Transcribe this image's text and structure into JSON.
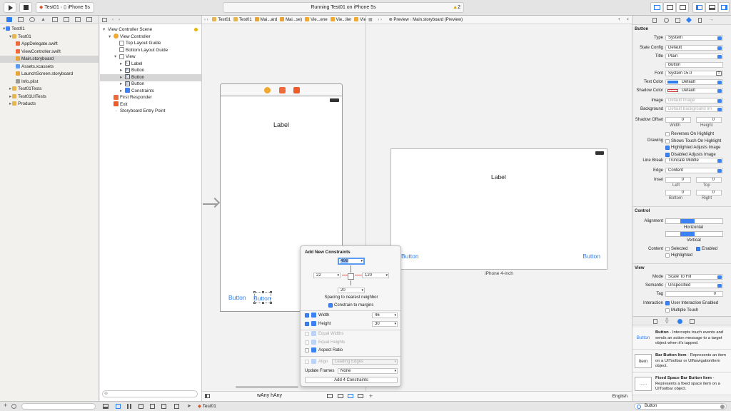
{
  "toolbar": {
    "scheme_project": "Test01",
    "scheme_device": "iPhone 5s",
    "status": "Running Test01 on iPhone 5s",
    "warnings": "2"
  },
  "navigator": {
    "items": [
      {
        "label": "Test01",
        "level": 0,
        "kind": "project"
      },
      {
        "label": "Test01",
        "level": 1,
        "kind": "folder"
      },
      {
        "label": "AppDelegate.swift",
        "level": 2,
        "kind": "swift"
      },
      {
        "label": "ViewController.swift",
        "level": 2,
        "kind": "swift"
      },
      {
        "label": "Main.storyboard",
        "level": 2,
        "kind": "storyboard"
      },
      {
        "label": "Assets.xcassets",
        "level": 2,
        "kind": "assets"
      },
      {
        "label": "LaunchScreen.storyboard",
        "level": 2,
        "kind": "storyboard"
      },
      {
        "label": "Info.plist",
        "level": 2,
        "kind": "plist"
      },
      {
        "label": "Test01Tests",
        "level": 1,
        "kind": "folder"
      },
      {
        "label": "Test01UITests",
        "level": 1,
        "kind": "folder"
      },
      {
        "label": "Products",
        "level": 1,
        "kind": "folder"
      }
    ]
  },
  "jumpbar": {
    "crumbs": [
      "Test01",
      "Test01",
      "Mai...ard",
      "Mai...se)",
      "Vie...ene",
      "Vie...ller",
      "View",
      "Button"
    ],
    "preview": "Preview",
    "preview_file": "Main.storyboard (Preview)"
  },
  "outline": {
    "items": [
      {
        "label": "View Controller Scene",
        "level": 0
      },
      {
        "label": "View Controller",
        "level": 1
      },
      {
        "label": "Top Layout Guide",
        "level": 2
      },
      {
        "label": "Bottom Layout Guide",
        "level": 2
      },
      {
        "label": "View",
        "level": 2
      },
      {
        "label": "Label",
        "level": 3,
        "badge": "L"
      },
      {
        "label": "Button",
        "level": 3,
        "badge": "B"
      },
      {
        "label": "Button",
        "level": 3,
        "badge": "B"
      },
      {
        "label": "Button",
        "level": 3,
        "badge": "B"
      },
      {
        "label": "Constraints",
        "level": 3,
        "badge": ""
      },
      {
        "label": "First Responder",
        "level": 1
      },
      {
        "label": "Exit",
        "level": 1
      },
      {
        "label": "Storyboard Entry Point",
        "level": 1
      }
    ]
  },
  "canvas": {
    "label": "Label",
    "button_left": "Button",
    "button_sel": "Button",
    "size_w": "wAny",
    "size_h": "hAny"
  },
  "preview": {
    "label": "Label",
    "button_left": "Button",
    "button_right": "Button",
    "device": "iPhone 4-inch",
    "language": "English"
  },
  "constraints": {
    "title": "Add New Constraints",
    "top": "498",
    "left": "22",
    "right": "120",
    "bottom": "20",
    "spacing": "Spacing to nearest neighbor",
    "margins": "Constrain to margins",
    "width_label": "Width",
    "width_value": "46",
    "height_label": "Height",
    "height_value": "30",
    "equal_widths": "Equal Widths",
    "equal_heights": "Equal Heights",
    "aspect": "Aspect Ratio",
    "align_label": "Align",
    "align_value": "Leading Edges",
    "update_label": "Update Frames",
    "update_value": "None",
    "add_button": "Add 4 Constraints"
  },
  "inspector": {
    "button_header": "Button",
    "type_label": "Type",
    "type_value": "System",
    "state_label": "State Config",
    "state_value": "Default",
    "title_label": "Title",
    "title_value": "Plain",
    "title_text": "Button",
    "font_label": "Font",
    "font_value": "System 15.0",
    "textcolor_label": "Text Color",
    "textcolor_value": "Default",
    "shadowcolor_label": "Shadow Color",
    "shadowcolor_value": "Default",
    "image_label": "Image",
    "image_ph": "Default Image",
    "bg_label": "Background",
    "bg_ph": "Default Background Im",
    "shadowoffset_label": "Shadow Offset",
    "so_w": "0",
    "so_h": "0",
    "width_cap": "Width",
    "height_cap": "Height",
    "drawing_label": "Drawing",
    "checks": [
      {
        "label": "Reverses On Highlight",
        "on": false
      },
      {
        "label": "Shows Touch On Highlight",
        "on": false
      },
      {
        "label": "Highlighted Adjusts Image",
        "on": true
      },
      {
        "label": "Disabled Adjusts Image",
        "on": true
      }
    ],
    "linebreak_label": "Line Break",
    "linebreak_value": "Truncate Middle",
    "edge_label": "Edge",
    "edge_value": "Content",
    "inset_label": "Inset",
    "inset_left": "0",
    "inset_top": "0",
    "inset_bottom": "0",
    "inset_right": "0",
    "left_cap": "Left",
    "top_cap": "Top",
    "bottom_cap": "Bottom",
    "right_cap": "Right",
    "control_header": "Control",
    "alignment_label": "Alignment",
    "horizontal_cap": "Horizontal",
    "vertical_cap": "Vertical",
    "content_label": "Content",
    "selected_label": "Selected",
    "enabled_label": "Enabled",
    "highlighted_label": "Highlighted",
    "view_header": "View",
    "mode_label": "Mode",
    "mode_value": "Scale To Fill",
    "semantic_label": "Semantic",
    "semantic_value": "Unspecified",
    "tag_label": "Tag",
    "tag_value": "0",
    "interaction_label": "Interaction",
    "uie_label": "User Interaction Enabled",
    "mt_label": "Multiple Touch"
  },
  "library": [
    {
      "icon": "Button",
      "title": "Button",
      "desc": "- Intercepts touch events and sends an action message to a target object when it's tapped."
    },
    {
      "icon": "Item",
      "title": "Bar Button Item",
      "desc": "- Represents an item on a UIToolbar or UINavigationItem object."
    },
    {
      "icon": "·····",
      "title": "Fixed Space Bar Button Item",
      "desc": "- Represents a fixed space item on a UIToolbar object."
    }
  ],
  "bottom": {
    "crumb": "Test01",
    "filter": "Button"
  },
  "colors": {
    "accent": "#2f7ef0",
    "selection": "#d6d6d6"
  }
}
